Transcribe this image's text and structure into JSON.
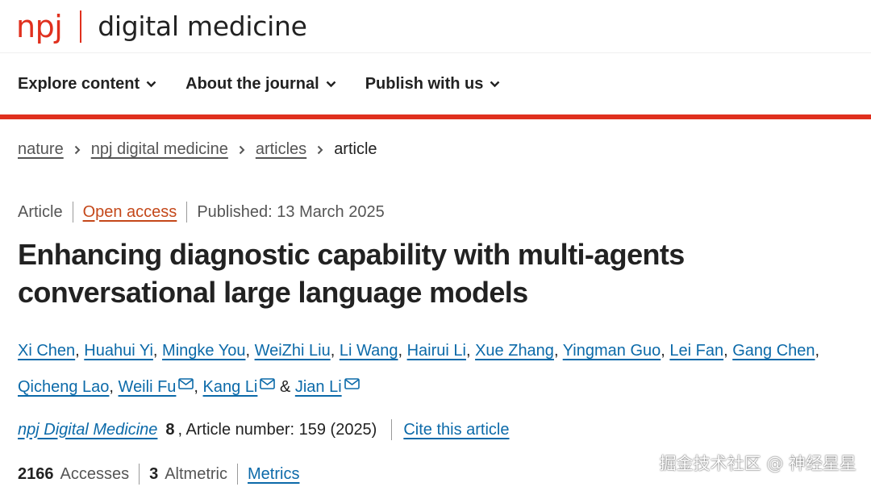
{
  "header": {
    "logo_brand": "npj",
    "logo_title": "digital medicine"
  },
  "nav": {
    "items": [
      {
        "label": "Explore content",
        "icon": "chevron-down-icon"
      },
      {
        "label": "About the journal",
        "icon": "chevron-down-icon"
      },
      {
        "label": "Publish with us",
        "icon": "chevron-down-icon"
      }
    ]
  },
  "breadcrumb": {
    "items": [
      "nature",
      "npj digital medicine",
      "articles"
    ],
    "current": "article",
    "separator_icon": "chevron-right-icon"
  },
  "article_meta": {
    "type": "Article",
    "access": "Open access",
    "published": "Published: 13 March 2025"
  },
  "article": {
    "title": "Enhancing diagnostic capability with multi-agents conversational large language models"
  },
  "authors": [
    {
      "name": "Xi Chen",
      "email": false
    },
    {
      "name": "Huahui Yi",
      "email": false
    },
    {
      "name": "Mingke You",
      "email": false
    },
    {
      "name": "WeiZhi Liu",
      "email": false
    },
    {
      "name": "Li Wang",
      "email": false
    },
    {
      "name": "Hairui Li",
      "email": false
    },
    {
      "name": "Xue Zhang",
      "email": false
    },
    {
      "name": "Yingman Guo",
      "email": false
    },
    {
      "name": "Lei Fan",
      "email": false
    },
    {
      "name": "Gang Chen",
      "email": false
    },
    {
      "name": "Qicheng Lao",
      "email": false
    },
    {
      "name": "Weili Fu",
      "email": true
    },
    {
      "name": "Kang Li",
      "email": true
    },
    {
      "name": "Jian Li",
      "email": true
    }
  ],
  "citation": {
    "journal": "npj Digital Medicine",
    "volume": "8",
    "article_number": ", Article number: 159 (2025)",
    "cite_label": "Cite this article"
  },
  "metrics": {
    "accesses_count": "2166",
    "accesses_label": "Accesses",
    "altmetric_count": "3",
    "altmetric_label": "Altmetric",
    "metrics_link": "Metrics"
  },
  "watermark": "掘金技术社区 @ 神经星星",
  "colors": {
    "brand_red": "#e0301e",
    "link_blue": "#0c6aa9",
    "open_access_orange": "#c4481a",
    "text_dark": "#222222",
    "text_muted": "#555555"
  }
}
